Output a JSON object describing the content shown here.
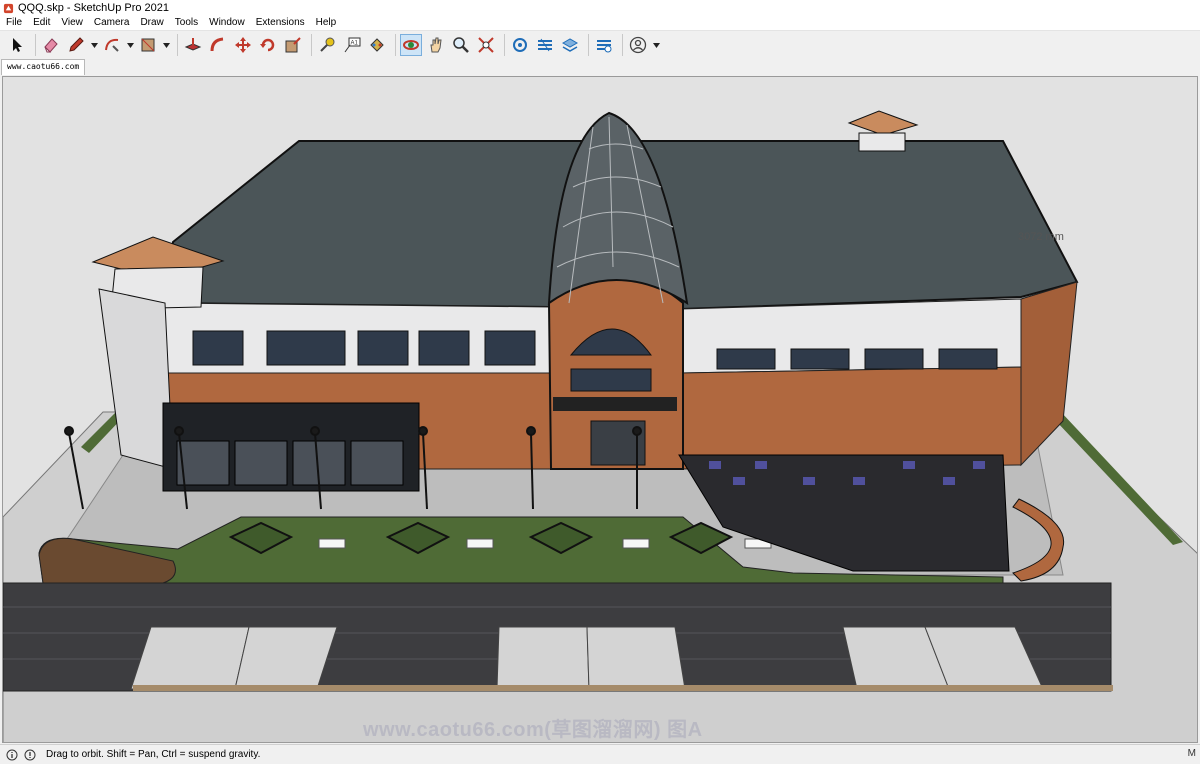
{
  "window": {
    "title": "QQQ.skp - SketchUp Pro 2021"
  },
  "menu": [
    {
      "id": "file",
      "label": "File"
    },
    {
      "id": "edit",
      "label": "Edit"
    },
    {
      "id": "view",
      "label": "View"
    },
    {
      "id": "camera",
      "label": "Camera"
    },
    {
      "id": "draw",
      "label": "Draw"
    },
    {
      "id": "tools",
      "label": "Tools"
    },
    {
      "id": "window",
      "label": "Window"
    },
    {
      "id": "extensions",
      "label": "Extensions"
    },
    {
      "id": "help",
      "label": "Help"
    }
  ],
  "toolbar": {
    "tools": [
      {
        "id": "select",
        "icon": "arrow-select-icon"
      },
      {
        "id": "eraser",
        "icon": "eraser-icon"
      },
      {
        "id": "line",
        "icon": "pencil-icon"
      },
      {
        "id": "arc",
        "icon": "arc-icon"
      },
      {
        "id": "rectangle",
        "icon": "rectangle-icon"
      },
      {
        "id": "push-pull",
        "icon": "push-pull-icon"
      },
      {
        "id": "follow-me",
        "icon": "follow-me-icon"
      },
      {
        "id": "move",
        "icon": "move-icon"
      },
      {
        "id": "rotate",
        "icon": "rotate-icon"
      },
      {
        "id": "scale",
        "icon": "scale-icon"
      },
      {
        "id": "tape-measure",
        "icon": "tape-measure-icon"
      },
      {
        "id": "text",
        "icon": "text-icon"
      },
      {
        "id": "paint-bucket",
        "icon": "paint-bucket-icon"
      },
      {
        "id": "orbit",
        "icon": "orbit-icon",
        "active": true
      },
      {
        "id": "pan",
        "icon": "pan-hand-icon"
      },
      {
        "id": "zoom",
        "icon": "zoom-icon"
      },
      {
        "id": "zoom-extents",
        "icon": "zoom-extents-icon"
      },
      {
        "id": "warehouse",
        "icon": "3d-warehouse-icon"
      },
      {
        "id": "extension-warehouse",
        "icon": "extension-warehouse-icon"
      },
      {
        "id": "layout",
        "icon": "layout-send-icon"
      },
      {
        "id": "extension-manager",
        "icon": "extension-manager-icon"
      },
      {
        "id": "account",
        "icon": "user-account-icon"
      }
    ]
  },
  "scene_tab": {
    "label": "www.caotu66.com"
  },
  "viewport": {
    "dimension_label": "3072 mm",
    "watermark": "www.caotu66.com(草图溜溜网) 图A"
  },
  "status": {
    "message": "Drag to orbit. Shift = Pan, Ctrl = suspend gravity.",
    "right_label": "M"
  },
  "colors": {
    "roof": "#4b5558",
    "brick": "#b0683f",
    "wall": "#e9e9ea",
    "lawn": "#4f6b36",
    "paving": "#3d3d40",
    "ground": "#e2e2e2",
    "active_tool": "#cde4f7"
  }
}
